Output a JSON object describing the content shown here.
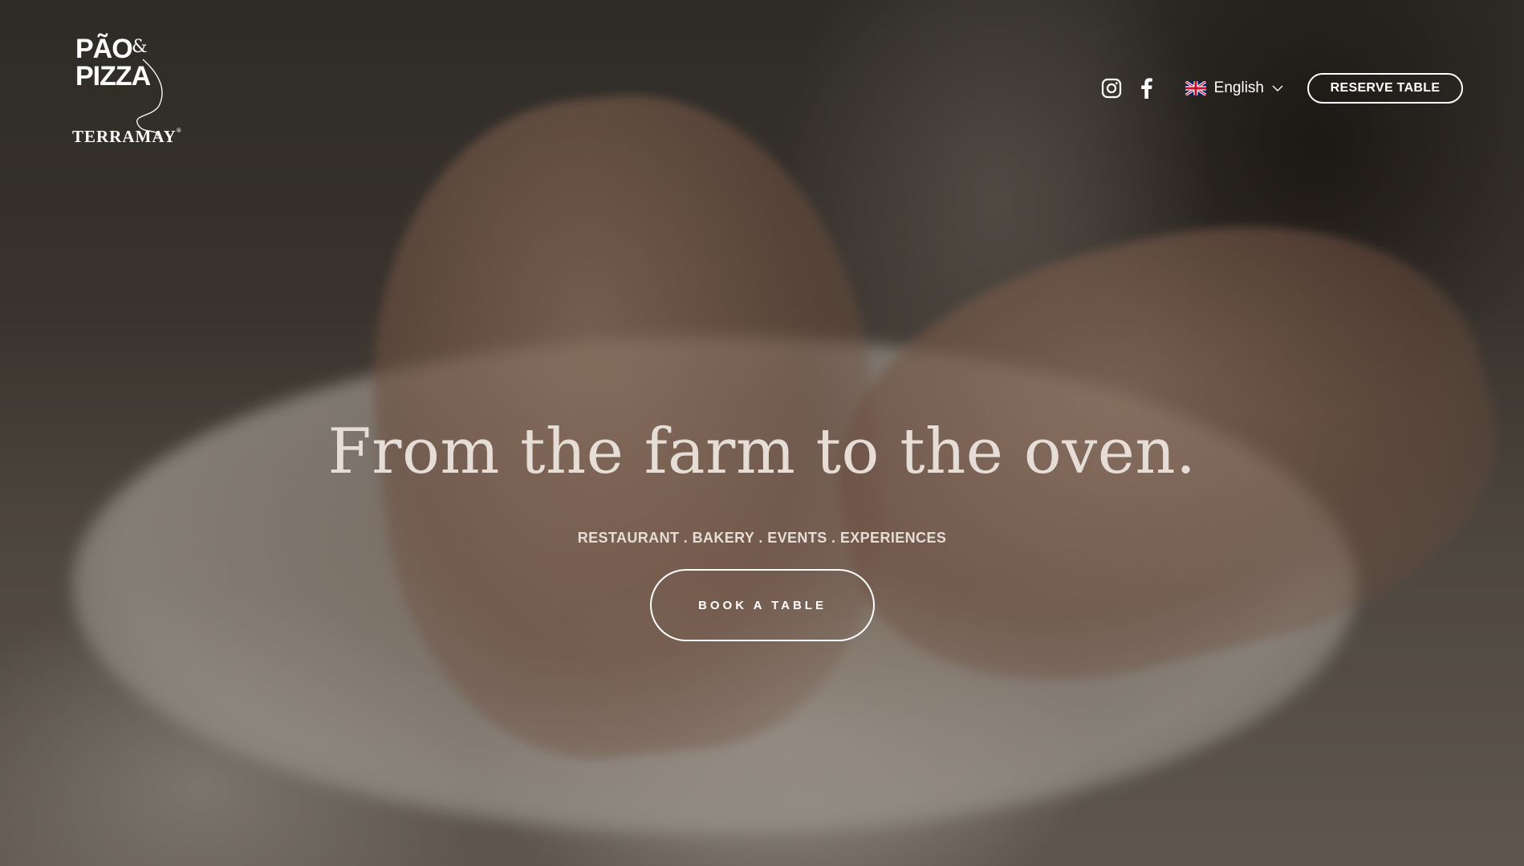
{
  "brand": {
    "logo_line1": "PÃO",
    "logo_amp": "&",
    "logo_line2": "PIZZA",
    "logo_brand": "TERRAMAY",
    "logo_mark": "®"
  },
  "header": {
    "social": [
      {
        "icon": "instagram-icon"
      },
      {
        "icon": "facebook-icon"
      }
    ],
    "language": {
      "flag": "uk-flag-icon",
      "label": "English"
    },
    "reserve_label": "RESERVE TABLE"
  },
  "hero": {
    "headline": "From the farm to the oven.",
    "tagline": "RESTAURANT . BAKERY . EVENTS . EXPERIENCES",
    "cta_label": "BOOK A TABLE"
  },
  "colors": {
    "text_light": "#e6ddd6",
    "white": "#ffffff",
    "overlay": "#19140f"
  }
}
